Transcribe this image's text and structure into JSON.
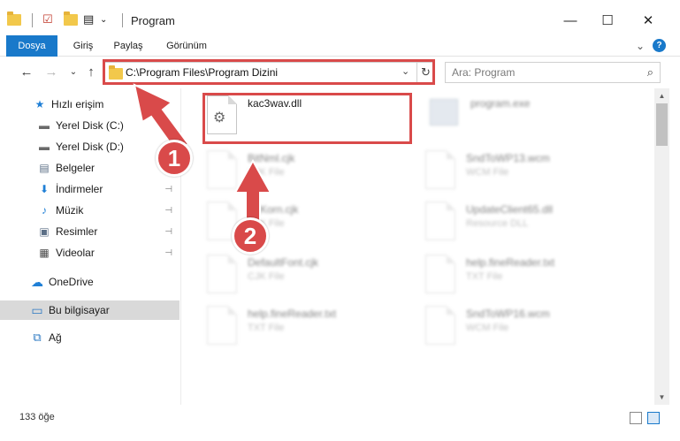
{
  "window": {
    "title": "Program",
    "minimize_glyph": "—",
    "maximize_glyph": "☐",
    "close_glyph": "✕"
  },
  "ribbon": {
    "tabs": [
      {
        "label": "Dosya"
      },
      {
        "label": "Giriş"
      },
      {
        "label": "Paylaş"
      },
      {
        "label": "Görünüm"
      }
    ],
    "expand_glyph": "⌄",
    "help_glyph": "?"
  },
  "address": {
    "path": "C:\\Program Files\\Program Dizini",
    "dropdown_glyph": "⌄",
    "refresh_glyph": "↻"
  },
  "search": {
    "placeholder": "Ara: Program",
    "icon_glyph": "⌕"
  },
  "nav": {
    "back_glyph": "←",
    "forward_glyph": "→",
    "recent_glyph": "⌄",
    "up_glyph": "↑"
  },
  "sidebar": {
    "items": [
      {
        "label": "Hızlı erişim",
        "icon": "star-icon",
        "glyph": "★",
        "pinned": false
      },
      {
        "label": "Yerel Disk (C:)",
        "icon": "drive-icon",
        "glyph": "▬",
        "pinned": true
      },
      {
        "label": "Yerel Disk (D:)",
        "icon": "drive-icon",
        "glyph": "▬",
        "pinned": true
      },
      {
        "label": "Belgeler",
        "icon": "document-icon",
        "glyph": "▤",
        "pinned": true
      },
      {
        "label": "İndirmeler",
        "icon": "download-icon",
        "glyph": "⬇",
        "pinned": true
      },
      {
        "label": "Müzik",
        "icon": "music-icon",
        "glyph": "♪",
        "pinned": true
      },
      {
        "label": "Resimler",
        "icon": "pictures-icon",
        "glyph": "▣",
        "pinned": true
      },
      {
        "label": "Videolar",
        "icon": "video-icon",
        "glyph": "▦",
        "pinned": true
      },
      {
        "label": "OneDrive",
        "icon": "cloud-icon",
        "glyph": "☁",
        "pinned": false
      },
      {
        "label": "Bu bilgisayar",
        "icon": "computer-icon",
        "glyph": "▭",
        "pinned": false
      },
      {
        "label": "Ağ",
        "icon": "network-icon",
        "glyph": "⧉",
        "pinned": false
      }
    ],
    "pin_glyph": "⊣"
  },
  "files": [
    {
      "name": "kac3wav.dll",
      "type": "",
      "icon": "gear-file-icon",
      "glyph": "⚙",
      "blurred": false
    },
    {
      "name": "program.exe",
      "type": "",
      "icon": "exe-icon",
      "blurred": true
    },
    {
      "name": "BitNml.cjk",
      "type": "CJK File",
      "icon": "file-icon",
      "blurred": true
    },
    {
      "name": "SndToWP13.wcm",
      "type": "WCM File",
      "icon": "file-icon",
      "blurred": true
    },
    {
      "name": "BitKorn.cjk",
      "type": "CJK File",
      "icon": "file-icon",
      "blurred": true
    },
    {
      "name": "UpdateClient65.dll",
      "type": "Resource DLL",
      "icon": "file-icon",
      "blurred": true
    },
    {
      "name": "DefaultFont.cjk",
      "type": "CJK File",
      "icon": "file-icon",
      "blurred": true
    },
    {
      "name": "help.fineReader.txt",
      "type": "TXT File",
      "icon": "file-icon",
      "blurred": true
    },
    {
      "name": "help.fineReader.txt",
      "type": "TXT File",
      "icon": "file-icon",
      "blurred": true
    },
    {
      "name": "SndToWP16.wcm",
      "type": "WCM File",
      "icon": "file-icon",
      "blurred": true
    }
  ],
  "scrollbar": {
    "up_glyph": "▲",
    "down_glyph": "▼"
  },
  "status": {
    "item_count": "133 öğe"
  },
  "annotations": {
    "step1": "1",
    "step2": "2",
    "color": "#d94a4a"
  }
}
